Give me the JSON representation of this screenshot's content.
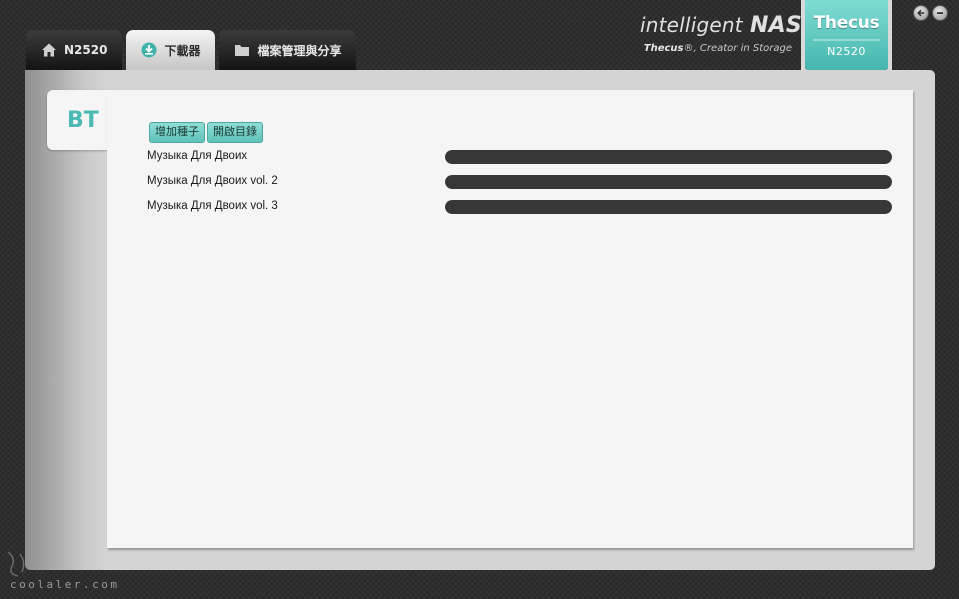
{
  "tabs": [
    {
      "label": "N2520",
      "icon": "home-icon",
      "active": false
    },
    {
      "label": "下載器",
      "icon": "download-icon",
      "active": true
    },
    {
      "label": "檔案管理與分享",
      "icon": "folder-icon",
      "active": false
    }
  ],
  "brand": {
    "title_prefix": "intelligent",
    "title_main": "NAS",
    "tagline_brand": "Thecus",
    "tagline_rest": "®, Creator in Storage"
  },
  "badge": {
    "logo": "Thecus",
    "model": "N2520"
  },
  "window_controls": {
    "back": "back-icon",
    "minimize": "minimize-icon"
  },
  "section": {
    "label": "BT"
  },
  "actions": {
    "add_torrent": "增加種子",
    "open_directory": "開啟目錄"
  },
  "torrents": [
    {
      "name": "Музыка Для Двоих",
      "progress": 1.0
    },
    {
      "name": "Музыка Для Двоих vol. 2",
      "progress": 1.0
    },
    {
      "name": "Музыка Для Двоих vol. 3",
      "progress": 1.0
    }
  ],
  "watermark": "coolaler.com",
  "colors": {
    "accent": "#4bbab4",
    "progress_fill": "#373737",
    "button": "#6ccbc3"
  }
}
